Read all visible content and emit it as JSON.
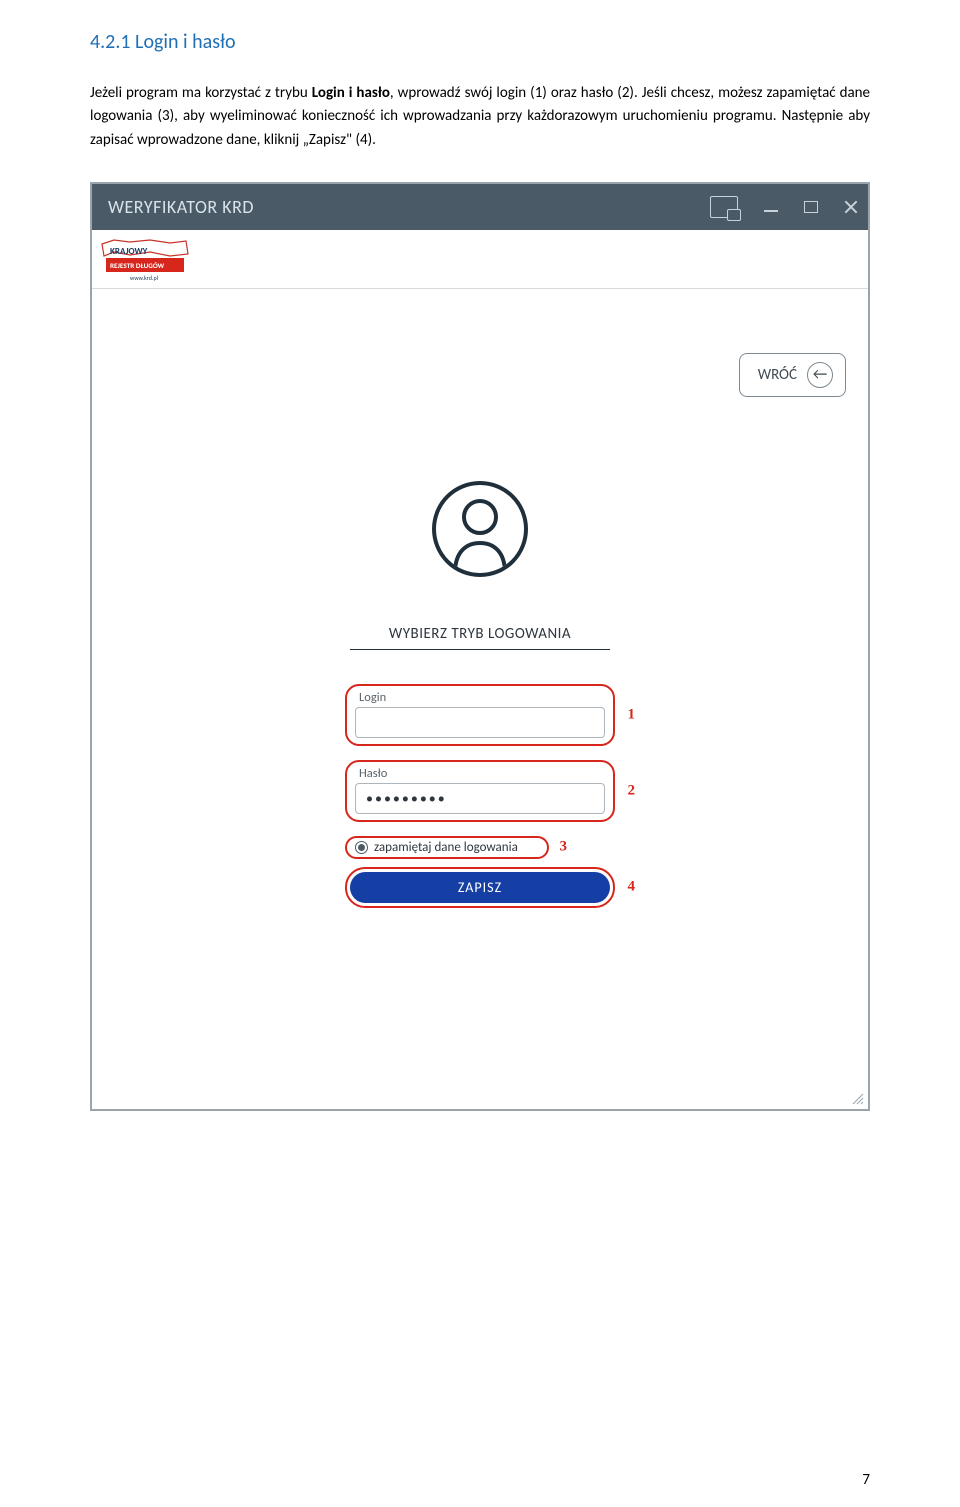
{
  "heading": "4.2.1 Login i hasło",
  "paragraph": {
    "pre": "Jeżeli program ma korzystać z trybu ",
    "bold": "Login i hasło",
    "post": ", wprowadź swój login (1) oraz hasło (2). Jeśli chcesz, możesz zapamiętać dane logowania (3), aby wyeliminować konieczność ich wprowadzania przy każdorazowym uruchomieniu programu. Następnie aby zapisać wprowadzone dane, kliknij „Zapisz\" (4)."
  },
  "window": {
    "title": "WERYFIKATOR KRD",
    "logo_top": "KRAJOWY",
    "logo_mid": "REJESTR DŁUGÓW",
    "logo_url": "www.krd.pl",
    "back_label": "WRÓĆ",
    "mode_label": "WYBIERZ TRYB LOGOWANIA",
    "login_label": "Login",
    "login_value": " ",
    "password_label": "Hasło",
    "password_value": "•••••••••",
    "remember_label": "zapamiętaj dane logowania",
    "save_label": "ZAPISZ"
  },
  "annotations": {
    "a1": "1",
    "a2": "2",
    "a3": "3",
    "a4": "4"
  },
  "page_number": "7"
}
